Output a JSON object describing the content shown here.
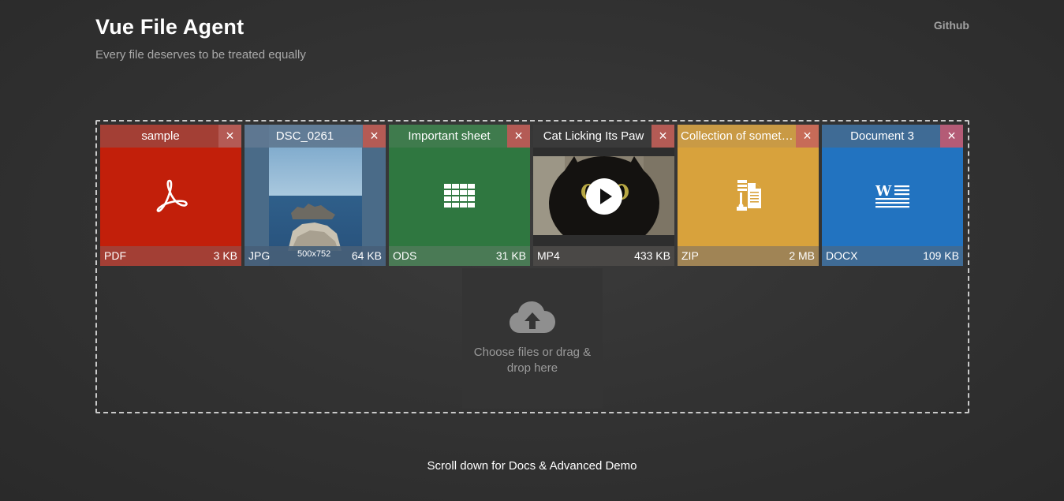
{
  "header": {
    "title": "Vue File Agent",
    "subtitle": "Every file deserves to be treated equally",
    "github_label": "Github"
  },
  "files": [
    {
      "name": "sample",
      "ext": "PDF",
      "size": "3 KB",
      "icon": "pdf-icon"
    },
    {
      "name": "DSC_0261",
      "ext": "JPG",
      "size": "64 KB",
      "dims": "500x752",
      "icon": "image-thumbnail"
    },
    {
      "name": "Important sheet",
      "ext": "ODS",
      "size": "31 KB",
      "icon": "spreadsheet-icon"
    },
    {
      "name": "Cat Licking Its Paw",
      "ext": "MP4",
      "size": "433 KB",
      "icon": "play-icon"
    },
    {
      "name": "Collection of someth...",
      "ext": "ZIP",
      "size": "2 MB",
      "icon": "archive-icon"
    },
    {
      "name": "Document 3",
      "ext": "DOCX",
      "size": "109 KB",
      "icon": "word-icon"
    }
  ],
  "remove_label": "×",
  "upload": {
    "text": "Choose files or drag & drop here",
    "icon": "cloud-upload-icon"
  },
  "footer": {
    "note": "Scroll down for Docs & Advanced Demo"
  },
  "colors": {
    "pdf": "#c21f0a",
    "ods": "#2f7740",
    "zip": "#d8a23c",
    "docx": "#2273c0",
    "background": "#333333"
  }
}
